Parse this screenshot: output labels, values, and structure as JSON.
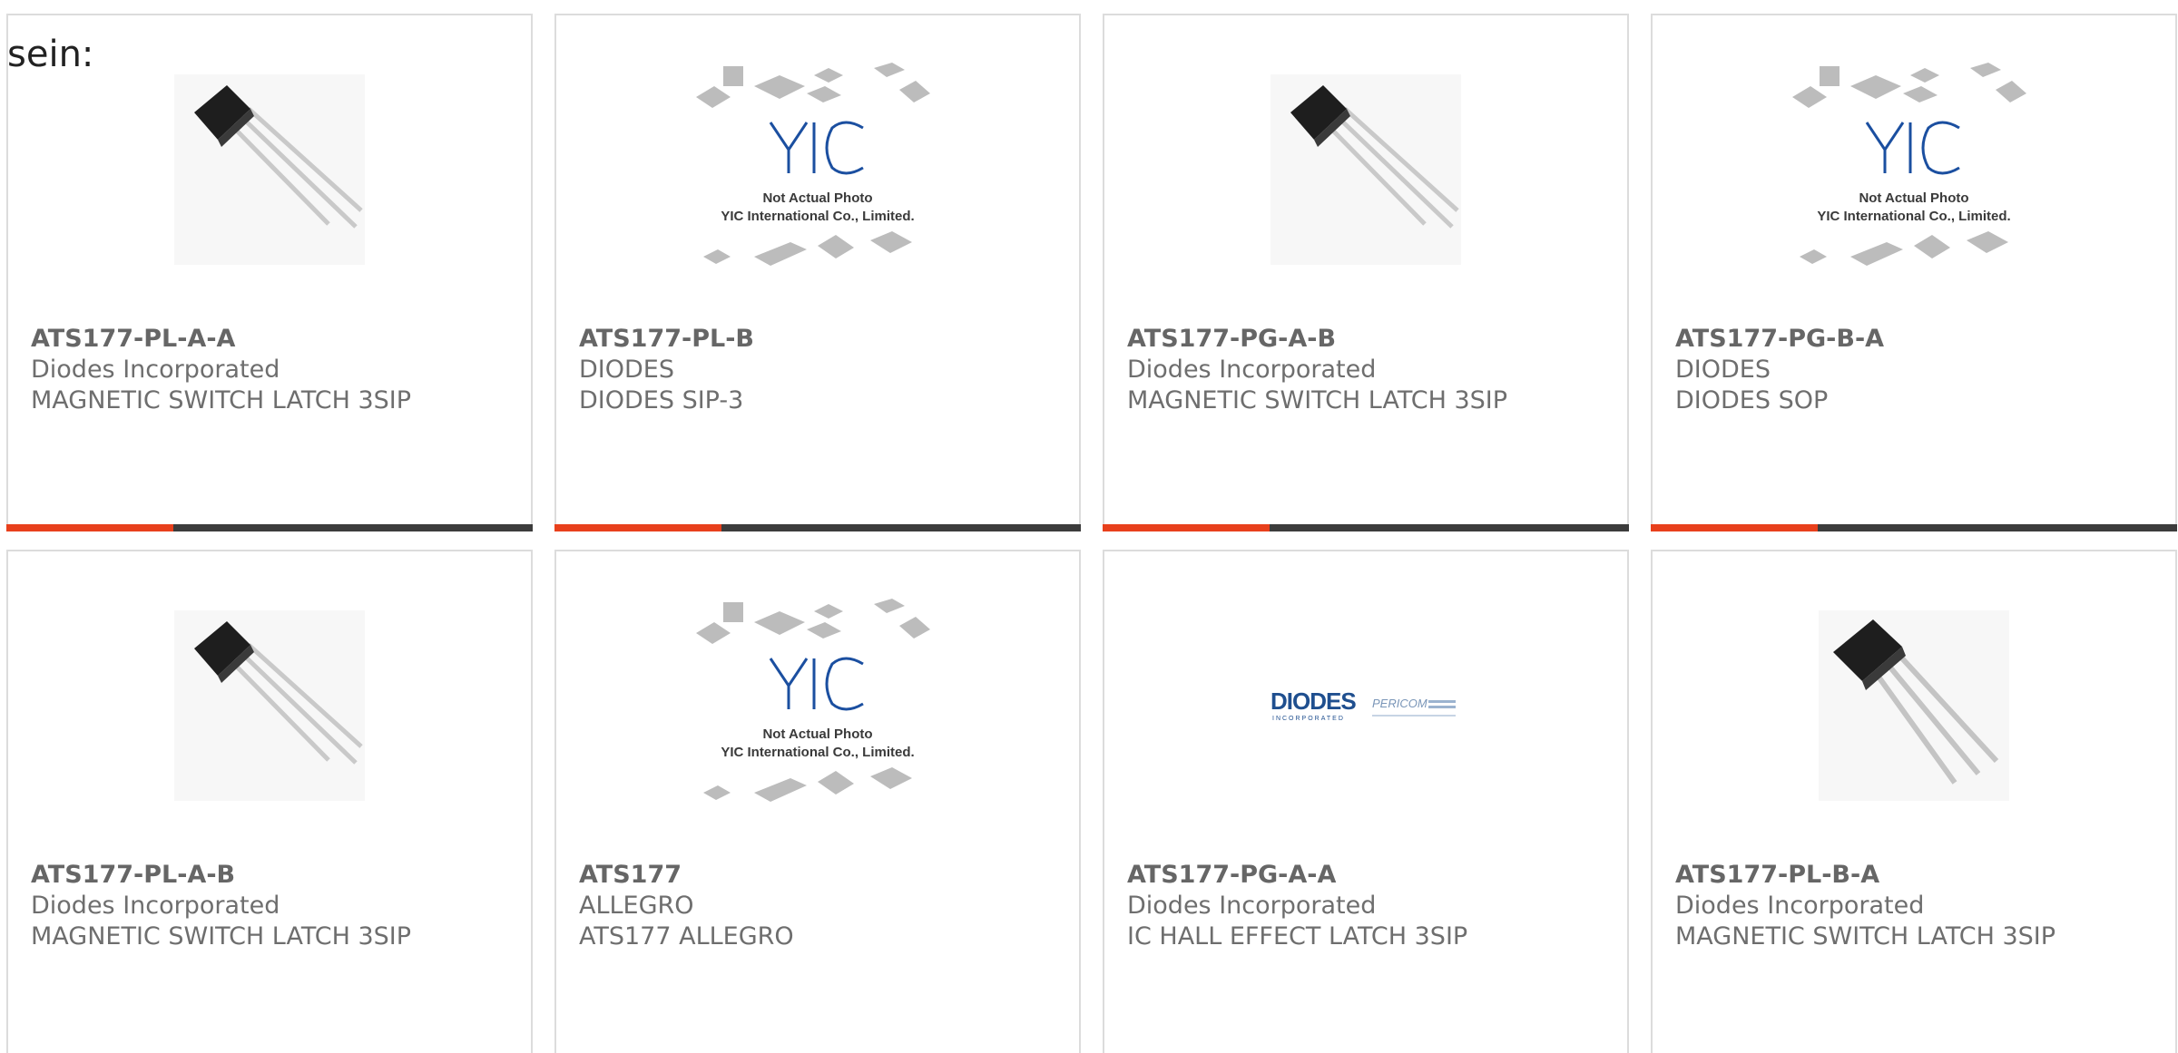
{
  "lead_text": "sein:",
  "colors": {
    "accent": "#e8401c",
    "bar": "#3c3c3c",
    "text": "#6e6e6e",
    "border": "#dcdcdc"
  },
  "products": [
    {
      "part": "ATS177-PL-A-A",
      "maker": "Diodes Incorporated",
      "desc": "MAGNETIC SWITCH LATCH 3SIP",
      "image": "transistor-photo"
    },
    {
      "part": "ATS177-PL-B",
      "maker": "DIODES",
      "desc": "DIODES SIP-3",
      "image": "yic-placeholder"
    },
    {
      "part": "ATS177-PG-A-B",
      "maker": "Diodes Incorporated",
      "desc": "MAGNETIC SWITCH LATCH 3SIP",
      "image": "transistor-photo"
    },
    {
      "part": "ATS177-PG-B-A",
      "maker": "DIODES",
      "desc": "DIODES SOP",
      "image": "yic-placeholder"
    },
    {
      "part": "ATS177-PL-A-B",
      "maker": "Diodes Incorporated",
      "desc": "MAGNETIC SWITCH LATCH 3SIP",
      "image": "transistor-photo"
    },
    {
      "part": "ATS177",
      "maker": "ALLEGRO",
      "desc": "ATS177 ALLEGRO",
      "image": "yic-placeholder"
    },
    {
      "part": "ATS177-PG-A-A",
      "maker": "Diodes Incorporated",
      "desc": "IC HALL EFFECT LATCH 3SIP",
      "image": "diodes-logo"
    },
    {
      "part": "ATS177-PL-B-A",
      "maker": "Diodes Incorporated",
      "desc": "MAGNETIC SWITCH LATCH 3SIP",
      "image": "transistor-photo"
    }
  ],
  "placeholder": {
    "logo": "YIC",
    "line1": "Not Actual Photo",
    "line2": "YIC International Co., Limited."
  },
  "diodes_logo": {
    "brand": "DIODES",
    "sub": "INCORPORATED",
    "brand2": "PERICOM"
  }
}
